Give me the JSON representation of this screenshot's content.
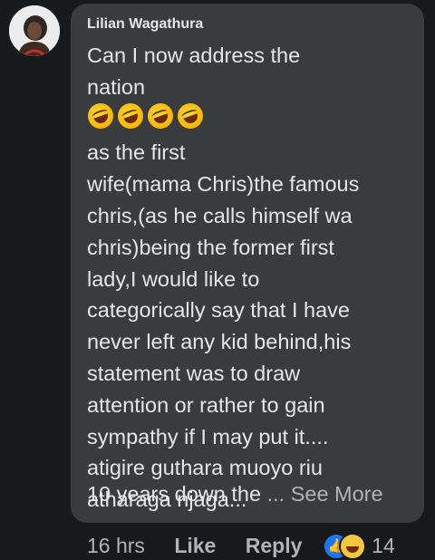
{
  "comment": {
    "author": "Lilian Wagathura",
    "lines": [
      "Can I now address the",
      "nation",
      "as the first",
      "wife(mama Chris)the famous",
      "chris,(as he calls himself wa",
      "chris)being the former first",
      "lady,I would like to",
      "categorically say that I have",
      "never left any kid behind,his",
      "statement was to draw",
      "attention or rather to gain",
      "sympathy if I may put it....",
      "atigire guthara muoyo riu",
      "atharaga njaga..."
    ],
    "emoji": "rolling-on-floor-laughing-icon",
    "emoji_count": 4,
    "truncated_text": "10 years down the",
    "see_more_label": "... See More"
  },
  "actions": {
    "timestamp": "16 hrs",
    "like_label": "Like",
    "reply_label": "Reply",
    "reaction_icons": [
      "like-icon",
      "haha-icon"
    ],
    "reaction_count": "14"
  },
  "colors": {
    "background": "#18191a",
    "bubble": "#3a3b3c",
    "text": "#e4e6eb",
    "muted": "#b0b3b8",
    "like_blue": "#1877f2"
  }
}
